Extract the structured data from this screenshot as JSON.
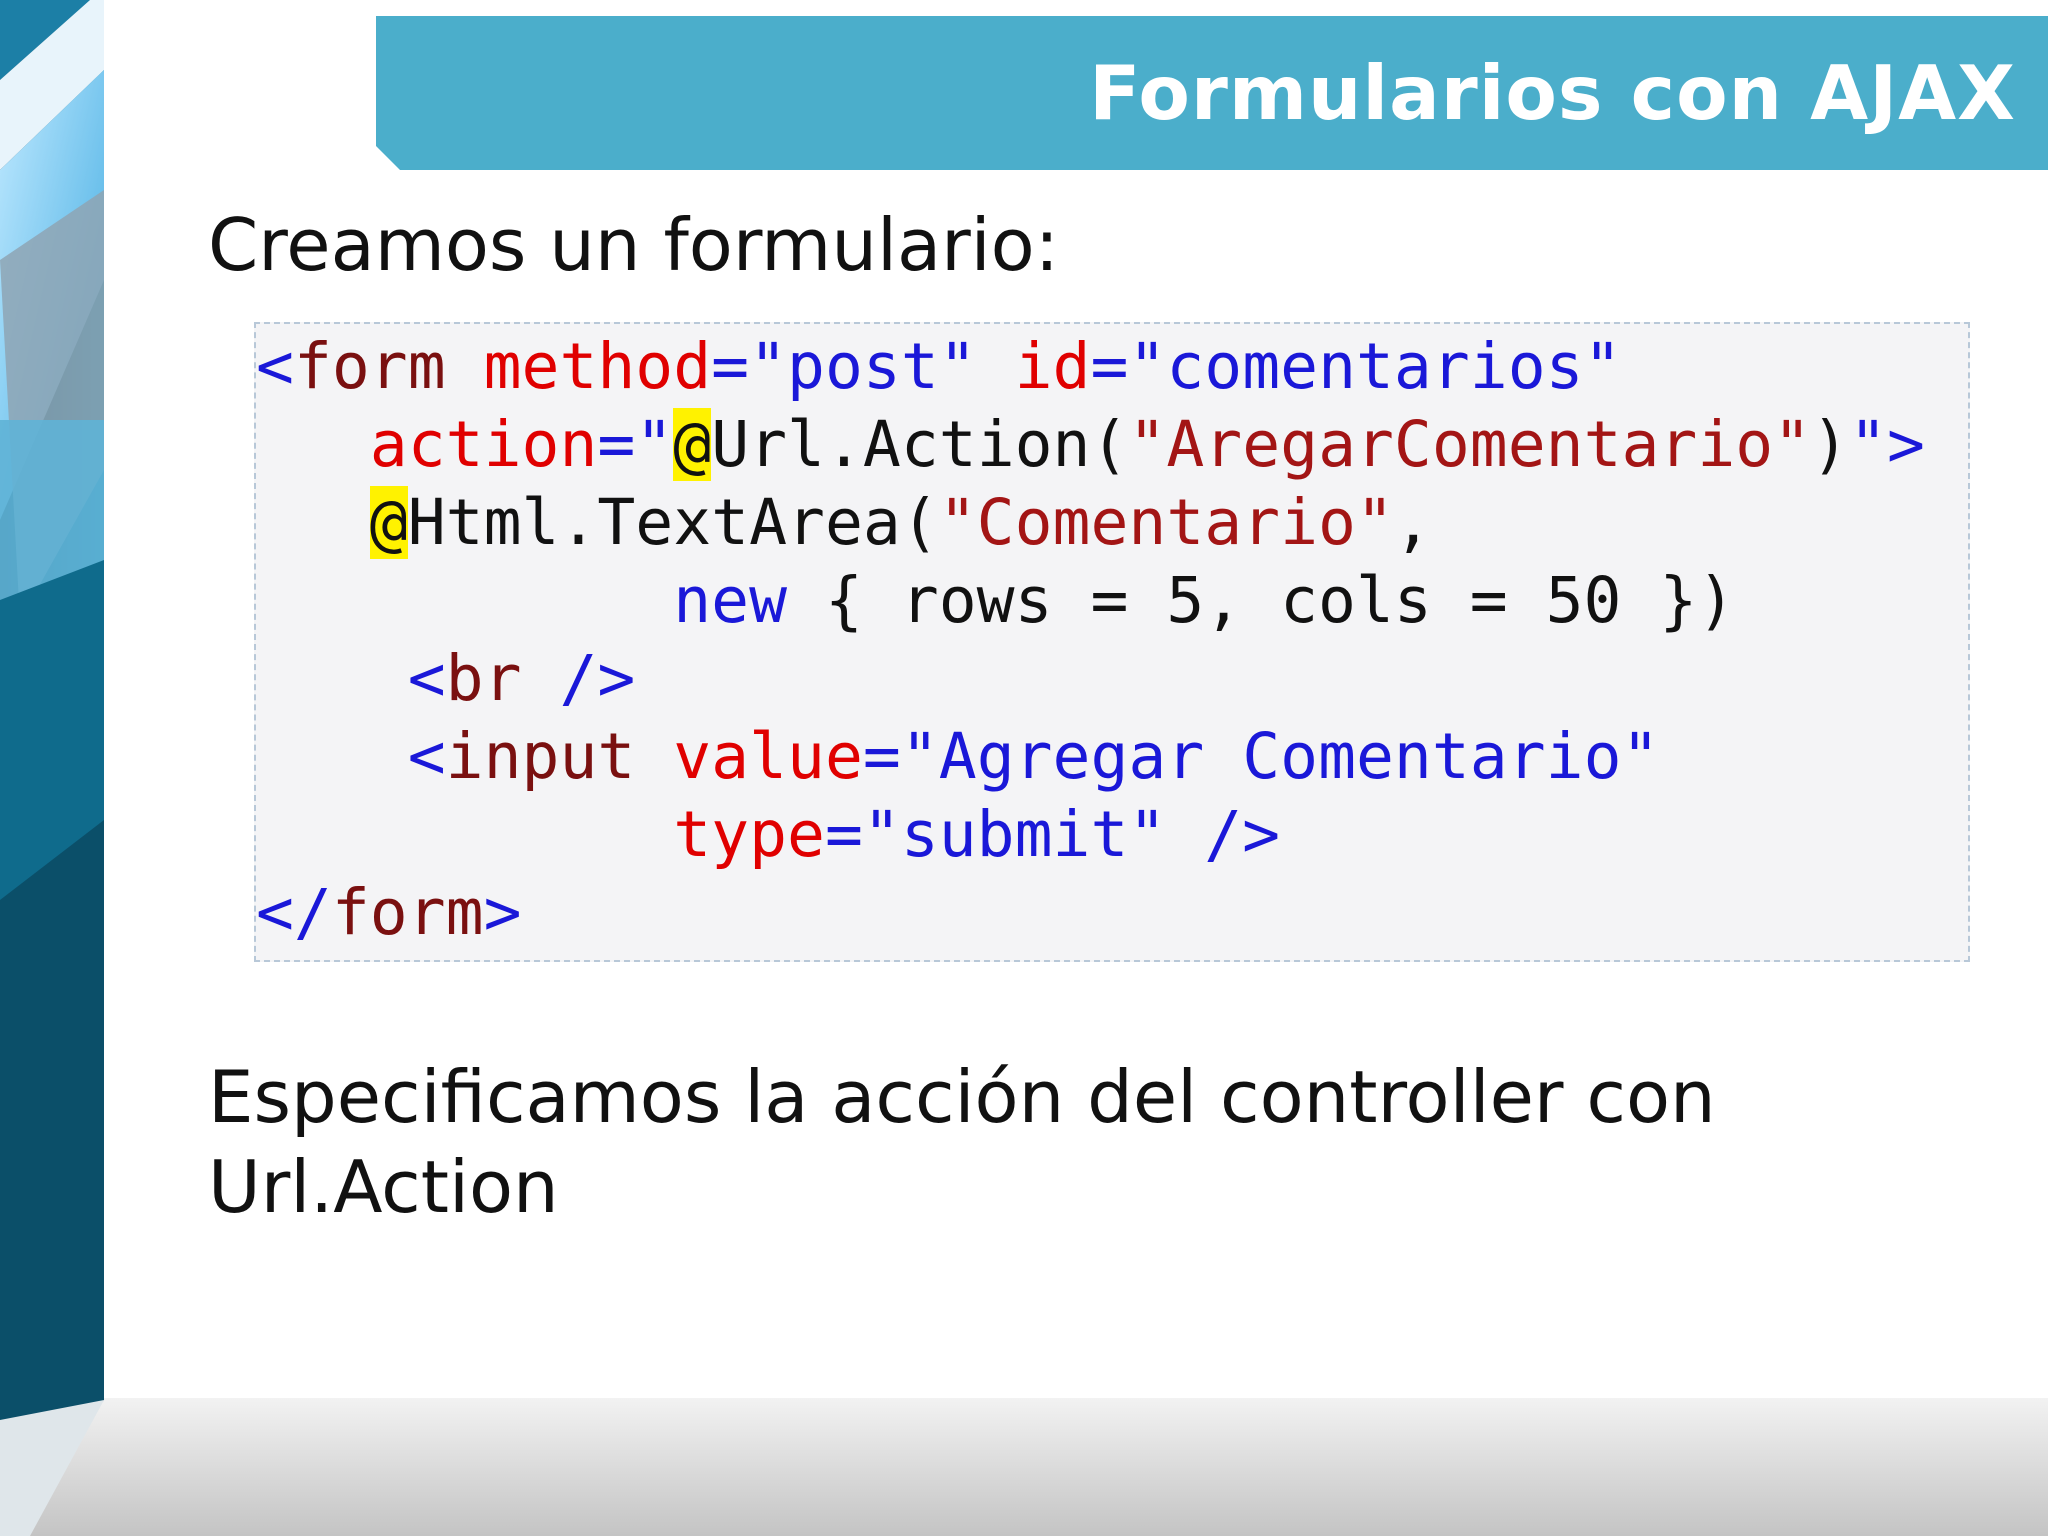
{
  "slide": {
    "title": "Formularios con AJAX",
    "intro": "Creamos un formulario:",
    "conclusion": "Especificamos la acción del controller con Url.Action"
  },
  "code": {
    "lines": [
      {
        "tokens": [
          {
            "t": "<",
            "c": "tag"
          },
          {
            "t": "form",
            "c": "el"
          },
          {
            "t": " ",
            "c": "txt"
          },
          {
            "t": "method",
            "c": "attr"
          },
          {
            "t": "=",
            "c": "tag"
          },
          {
            "t": "\"post\"",
            "c": "val"
          },
          {
            "t": " ",
            "c": "txt"
          },
          {
            "t": "id",
            "c": "attr"
          },
          {
            "t": "=",
            "c": "tag"
          },
          {
            "t": "\"comentarios\"",
            "c": "val"
          }
        ]
      },
      {
        "tokens": [
          {
            "t": "   ",
            "c": "txt"
          },
          {
            "t": "action",
            "c": "attr"
          },
          {
            "t": "=",
            "c": "tag"
          },
          {
            "t": "\"",
            "c": "val"
          },
          {
            "t": "@",
            "c": "at"
          },
          {
            "t": "Url.Action(",
            "c": "txt"
          },
          {
            "t": "\"AregarComentario\"",
            "c": "str"
          },
          {
            "t": ")",
            "c": "txt"
          },
          {
            "t": "\"",
            "c": "val"
          },
          {
            "t": ">",
            "c": "tag"
          }
        ]
      },
      {
        "tokens": [
          {
            "t": "   ",
            "c": "txt"
          },
          {
            "t": "@",
            "c": "at"
          },
          {
            "t": "Html.TextArea(",
            "c": "txt"
          },
          {
            "t": "\"Comentario\"",
            "c": "str"
          },
          {
            "t": ",",
            "c": "txt"
          }
        ]
      },
      {
        "tokens": [
          {
            "t": "           ",
            "c": "txt"
          },
          {
            "t": "new",
            "c": "kw"
          },
          {
            "t": " { rows = 5, cols = 50 })",
            "c": "txt"
          }
        ]
      },
      {
        "tokens": [
          {
            "t": "    ",
            "c": "txt"
          },
          {
            "t": "<",
            "c": "tag"
          },
          {
            "t": "br",
            "c": "el"
          },
          {
            "t": " />",
            "c": "tag"
          }
        ]
      },
      {
        "tokens": [
          {
            "t": "    ",
            "c": "txt"
          },
          {
            "t": "<",
            "c": "tag"
          },
          {
            "t": "input",
            "c": "el"
          },
          {
            "t": " ",
            "c": "txt"
          },
          {
            "t": "value",
            "c": "attr"
          },
          {
            "t": "=",
            "c": "tag"
          },
          {
            "t": "\"Agregar Comentario\"",
            "c": "val"
          }
        ]
      },
      {
        "tokens": [
          {
            "t": "           ",
            "c": "txt"
          },
          {
            "t": "type",
            "c": "attr"
          },
          {
            "t": "=",
            "c": "tag"
          },
          {
            "t": "\"submit\"",
            "c": "val"
          },
          {
            "t": " />",
            "c": "tag"
          }
        ]
      },
      {
        "tokens": [
          {
            "t": "</",
            "c": "tag"
          },
          {
            "t": "form",
            "c": "el"
          },
          {
            "t": ">",
            "c": "tag"
          }
        ]
      }
    ]
  },
  "colors": {
    "banner": "#4baecb",
    "tag": "#1a18d8",
    "element": "#7a1010",
    "attribute": "#e00000",
    "string": "#a31515",
    "highlight": "#fff200"
  }
}
